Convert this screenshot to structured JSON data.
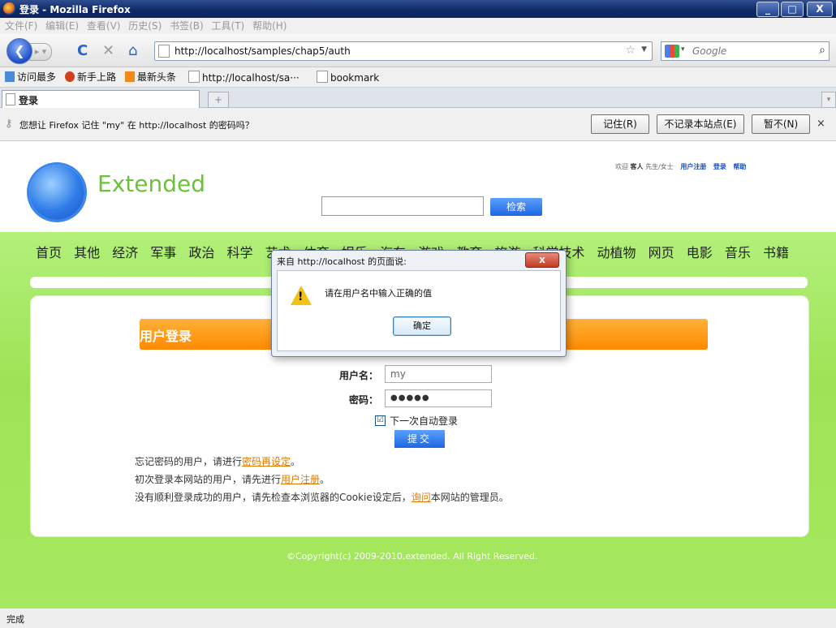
{
  "window": {
    "title": "登录 - Mozilla Firefox",
    "min": "_",
    "max": "□",
    "close": "X"
  },
  "menu": [
    "文件(F)",
    "编辑(E)",
    "查看(V)",
    "历史(S)",
    "书签(B)",
    "工具(T)",
    "帮助(H)"
  ],
  "nav": {
    "url": "http://localhost/samples/chap5/auth",
    "search_placeholder": "Google"
  },
  "bookmarks": [
    "访问最多",
    "新手上路",
    "最新头条",
    "http://localhost/sa···",
    "bookmark"
  ],
  "tab": {
    "title": "登录",
    "new_tab": "+"
  },
  "notification": {
    "message": "您想让 Firefox 记住 \"my\" 在 http://localhost 的密码吗？",
    "remember": "记住(R)",
    "never": "不记录本站点(E)",
    "not_now": "暂不(N)",
    "close": "×"
  },
  "site": {
    "brand": "Extended",
    "top_links": {
      "welcome": "欢迎",
      "guest": "客人",
      "title": "先生/女士",
      "register": "用户注册",
      "login": "登录",
      "help": "帮助"
    },
    "search_button": "检索",
    "nav_items": [
      "首页",
      "其他",
      "经济",
      "军事",
      "政治",
      "科学",
      "艺术",
      "体育",
      "娱乐",
      "汽车",
      "游戏",
      "教育",
      "旅游",
      "科学技术",
      "动植物",
      "网页",
      "电影",
      "音乐",
      "书籍"
    ]
  },
  "login": {
    "title": "用户登录",
    "username_label": "用户名：",
    "username_value": "my",
    "password_label": "密码：",
    "password_value": "●●●●●",
    "auto_login_checked": "☑",
    "auto_login": "下一次自动登录",
    "submit": "提交",
    "info1_pre": "忘记密码的用户，请进行",
    "info1_link": "密码再设定",
    "info1_post": "。",
    "info2_pre": "初次登录本网站的用户，请先进行",
    "info2_link": "用户注册",
    "info2_post": "。",
    "info3_pre": "没有顺利登录成功的用户，请先检查本浏览器的Cookie设定后，",
    "info3_link": "询问",
    "info3_post": "本网站的管理员。"
  },
  "copyright": "©Copyright(c) 2009-2010,extended. All Right Reserved.",
  "status": "完成",
  "dialog": {
    "title": "来自 http://localhost 的页面说:",
    "message": "请在用户名中输入正确的值",
    "ok": "确定",
    "close": "x"
  }
}
